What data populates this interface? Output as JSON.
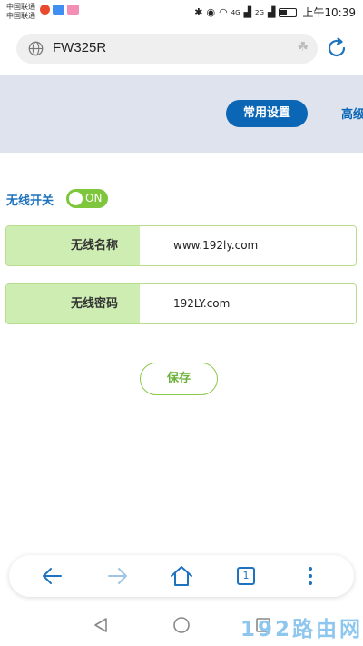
{
  "status_bar": {
    "carriers": [
      "中国联通",
      "中国联通"
    ],
    "network_4g": "4G",
    "network_2g": "2G",
    "time": "上午10:39"
  },
  "browser": {
    "url": "FW325R"
  },
  "nav": {
    "active_tab": "常用设置",
    "next_tab": "高级"
  },
  "wireless": {
    "switch_label": "无线开关",
    "switch_state": "ON",
    "fields": [
      {
        "label": "无线名称",
        "value": "www.192ly.com"
      },
      {
        "label": "无线密码",
        "value": "192LY.com"
      }
    ],
    "save_label": "保存"
  },
  "toolbar": {
    "tab_count": "1"
  },
  "watermark": "192路由网",
  "colors": {
    "primary_blue": "#0b67b5",
    "label_blue": "#1e73be",
    "toggle_green": "#7ec63b",
    "row_label_bg": "#cdedb2",
    "header_band": "#dfe3ee"
  }
}
